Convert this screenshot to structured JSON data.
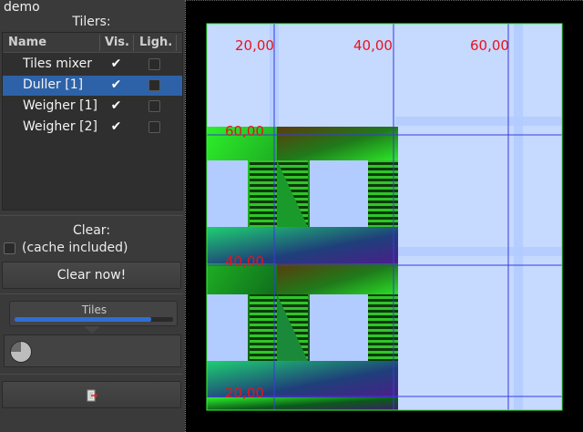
{
  "window": {
    "title": "demo"
  },
  "panel": {
    "tilers_label": "Tilers:",
    "columns": {
      "name": "Name",
      "vis": "Vis.",
      "ligh": "Ligh."
    },
    "rows": [
      {
        "name": "Tiles mixer",
        "vis": true,
        "ligh": false,
        "selected": false,
        "cut": "("
      },
      {
        "name": "Duller [1]",
        "vis": true,
        "ligh": false,
        "selected": true,
        "cut": "("
      },
      {
        "name": "Weigher [1]",
        "vis": true,
        "ligh": false,
        "selected": false,
        "cut": "("
      },
      {
        "name": "Weigher [2]",
        "vis": true,
        "ligh": false,
        "selected": false,
        "cut": "("
      }
    ],
    "clear_label": "Clear:",
    "cache_label": "(cache included)",
    "clear_button": "Clear now!",
    "tiles_label": "Tiles",
    "tiles_progress": 0.86,
    "pie_fraction": 0.75
  },
  "canvas": {
    "top_labels": [
      "20,00",
      "40,00",
      "60,00"
    ],
    "side_labels": [
      "60,00",
      "40,00",
      "20,00"
    ],
    "label_color": "#e8131c",
    "grid_color": "#3a3adc",
    "bg_color": "#c6d9ff",
    "border_color": "#30ff30",
    "accent_green": "#35e82a"
  }
}
